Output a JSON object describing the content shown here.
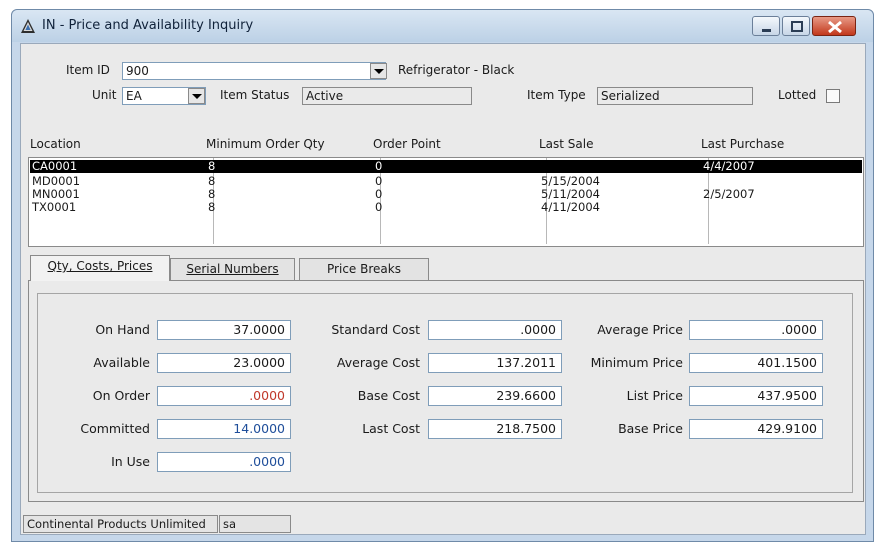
{
  "window": {
    "title": "IN - Price and Availability Inquiry"
  },
  "item": {
    "id_label": "Item ID",
    "id_value": "900",
    "description": "Refrigerator - Black",
    "unit_label": "Unit",
    "unit_value": "EA",
    "status_label": "Item Status",
    "status_value": "Active",
    "type_label": "Item Type",
    "type_value": "Serialized",
    "lotted_label": "Lotted",
    "lotted_checked": false
  },
  "locations": {
    "columns": [
      "Location",
      "Minimum Order Qty",
      "Order Point",
      "Last Sale",
      "Last Purchase"
    ],
    "rows": [
      {
        "location": "CA0001",
        "min_qty": "8",
        "order_point": "0",
        "last_sale": "",
        "last_purchase": "4/4/2007",
        "selected": true
      },
      {
        "location": "MD0001",
        "min_qty": "8",
        "order_point": "0",
        "last_sale": "5/15/2004",
        "last_purchase": ""
      },
      {
        "location": "MN0001",
        "min_qty": "8",
        "order_point": "0",
        "last_sale": "5/11/2004",
        "last_purchase": "2/5/2007"
      },
      {
        "location": "TX0001",
        "min_qty": "8",
        "order_point": "0",
        "last_sale": "4/11/2004",
        "last_purchase": ""
      }
    ]
  },
  "tabs": [
    {
      "label": "Qty, Costs, Prices",
      "active": true
    },
    {
      "label": "Serial Numbers",
      "active": false
    },
    {
      "label": "Price Breaks",
      "active": false
    }
  ],
  "qty": {
    "on_hand_label": "On Hand",
    "on_hand": "37.0000",
    "available_label": "Available",
    "available": "23.0000",
    "on_order_label": "On Order",
    "on_order": ".0000",
    "committed_label": "Committed",
    "committed": "14.0000",
    "in_use_label": "In Use",
    "in_use": ".0000"
  },
  "costs": {
    "standard_label": "Standard Cost",
    "standard": ".0000",
    "average_label": "Average Cost",
    "average": "137.2011",
    "base_label": "Base Cost",
    "base": "239.6600",
    "last_label": "Last Cost",
    "last": "218.7500"
  },
  "prices": {
    "average_label": "Average Price",
    "average": ".0000",
    "minimum_label": "Minimum Price",
    "minimum": "401.1500",
    "list_label": "List Price",
    "list": "437.9500",
    "base_label": "Base Price",
    "base": "429.9100"
  },
  "status": {
    "company": "Continental Products Unlimited",
    "user": "sa"
  },
  "colors": {
    "selected_row_bg": "#000000",
    "negative_value": "#c0392b",
    "committed_value": "#1f4e9a"
  }
}
